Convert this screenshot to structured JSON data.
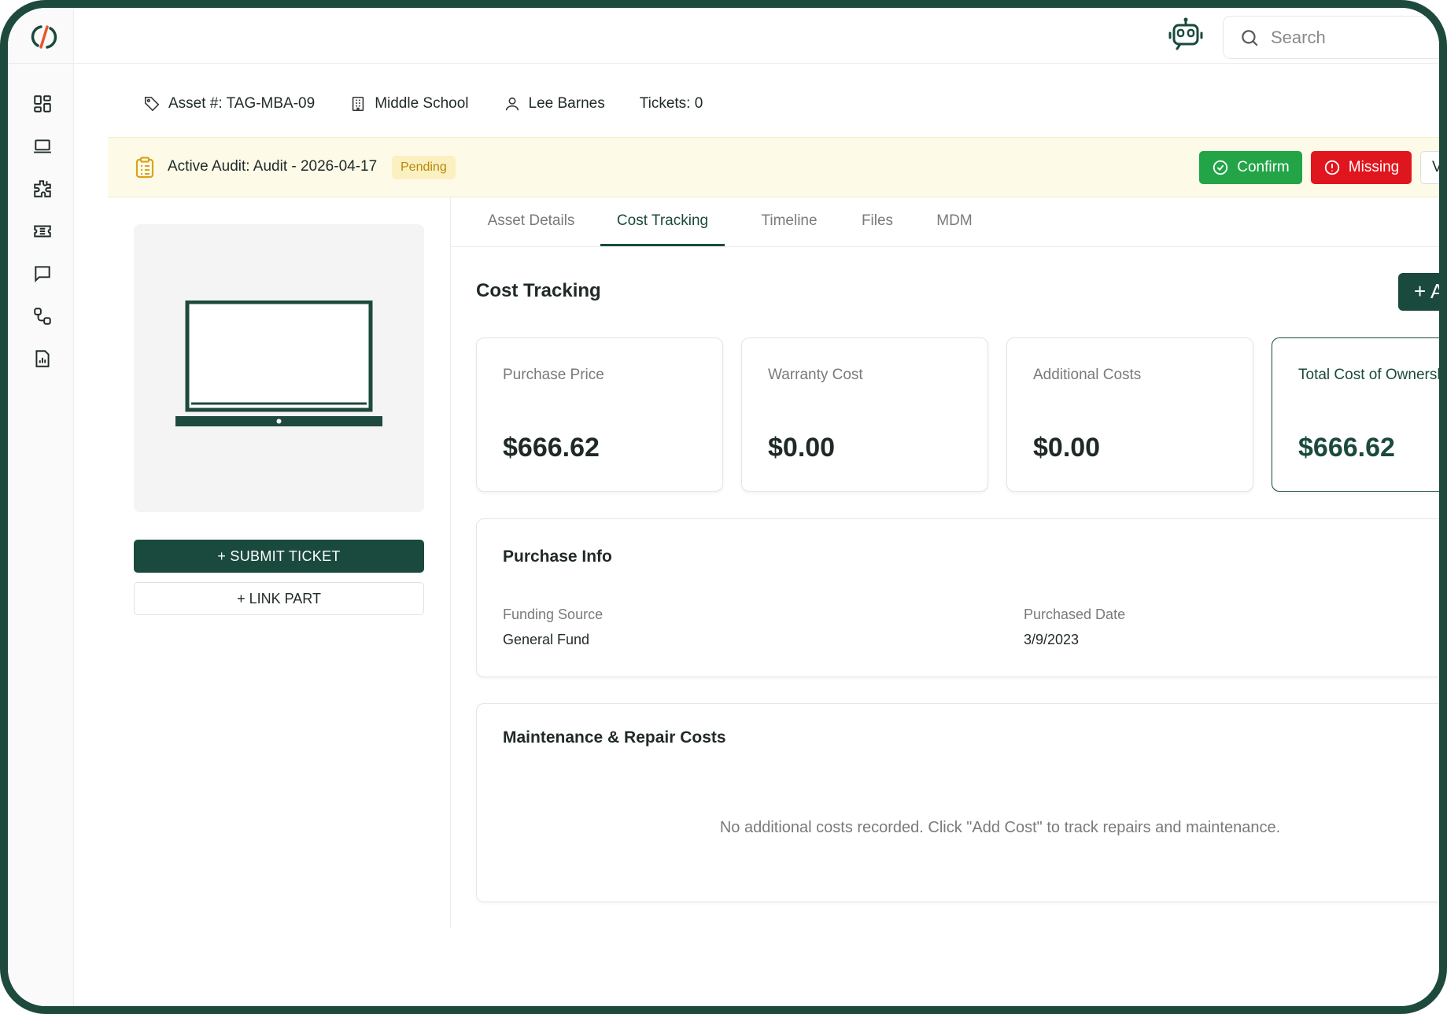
{
  "header": {
    "search_placeholder": "Search"
  },
  "sidebar": {
    "items": [
      {
        "name": "dashboard-icon"
      },
      {
        "name": "laptop-icon"
      },
      {
        "name": "puzzle-icon"
      },
      {
        "name": "ticket-icon"
      },
      {
        "name": "chat-icon"
      },
      {
        "name": "workflow-icon"
      },
      {
        "name": "report-icon"
      }
    ]
  },
  "asset": {
    "asset_number": "Asset #: TAG-MBA-09",
    "location": "Middle School",
    "assignee": "Lee Barnes",
    "tickets": "Tickets: 0"
  },
  "audit": {
    "text": "Active Audit: Audit - 2026-04-17",
    "status": "Pending",
    "confirm_label": "Confirm",
    "missing_label": "Missing",
    "view_label": "Vi"
  },
  "actions": {
    "submit_ticket": "+ SUBMIT TICKET",
    "link_part": "+ LINK PART"
  },
  "tabs": [
    {
      "label": "Asset Details"
    },
    {
      "label": "Cost Tracking"
    },
    {
      "label": "Timeline"
    },
    {
      "label": "Files"
    },
    {
      "label": "MDM"
    }
  ],
  "active_tab": "Cost Tracking",
  "cost_tracking": {
    "title": "Cost Tracking",
    "add_button": "+  A",
    "cards": [
      {
        "label": "Purchase Price",
        "value": "$666.62"
      },
      {
        "label": "Warranty Cost",
        "value": "$0.00"
      },
      {
        "label": "Additional Costs",
        "value": "$0.00"
      },
      {
        "label": "Total Cost of Ownershi",
        "value": "$666.62"
      }
    ]
  },
  "purchase_info": {
    "title": "Purchase Info",
    "funding_source_label": "Funding Source",
    "funding_source_value": "General Fund",
    "purchased_date_label": "Purchased Date",
    "purchased_date_value": "3/9/2023"
  },
  "maintenance": {
    "title": "Maintenance & Repair Costs",
    "empty_message": "No additional costs recorded. Click \"Add Cost\" to track repairs and maintenance."
  },
  "colors": {
    "brand": "#1a4a3d",
    "confirm": "#22a447",
    "missing": "#e0161e",
    "audit_bg": "#fdfae8",
    "pending_text": "#b8860b"
  }
}
